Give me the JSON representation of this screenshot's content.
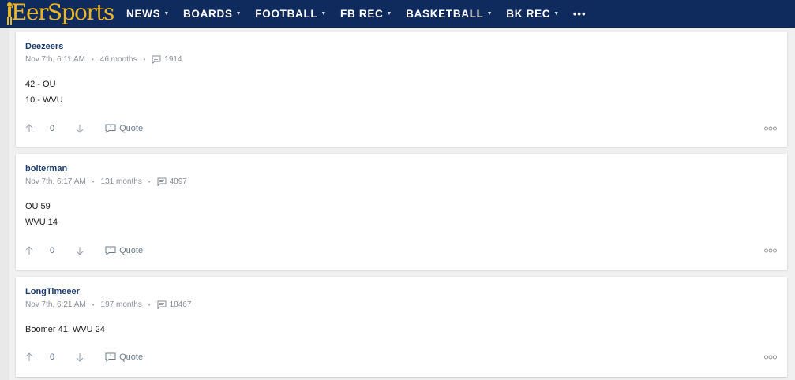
{
  "navbar": {
    "logo_text": "EerSports",
    "items": [
      {
        "label": "NEWS"
      },
      {
        "label": "BOARDS"
      },
      {
        "label": "FOOTBALL"
      },
      {
        "label": "FB REC"
      },
      {
        "label": "BASKETBALL"
      },
      {
        "label": "BK REC"
      }
    ],
    "more_label": "•••"
  },
  "posts": [
    {
      "username": "Deezeers",
      "time": "Nov 7th, 6:11 AM",
      "tenure": "46 months",
      "post_count": "1914",
      "lines": [
        "42 - OU",
        "10 - WVU"
      ],
      "score": "0",
      "quote_label": "Quote"
    },
    {
      "username": "bolterman",
      "time": "Nov 7th, 6:17 AM",
      "tenure": "131 months",
      "post_count": "4897",
      "lines": [
        "OU 59",
        "WVU 14"
      ],
      "score": "0",
      "quote_label": "Quote"
    },
    {
      "username": "LongTimeeer",
      "time": "Nov 7th, 6:21 AM",
      "tenure": "197 months",
      "post_count": "18467",
      "lines": [
        "Boomer 41, WVU 24"
      ],
      "score": "0",
      "quote_label": "Quote"
    }
  ],
  "colors": {
    "navbar": "#0f2a5c",
    "logo": "#e9b626",
    "username": "#1c3b6e"
  }
}
